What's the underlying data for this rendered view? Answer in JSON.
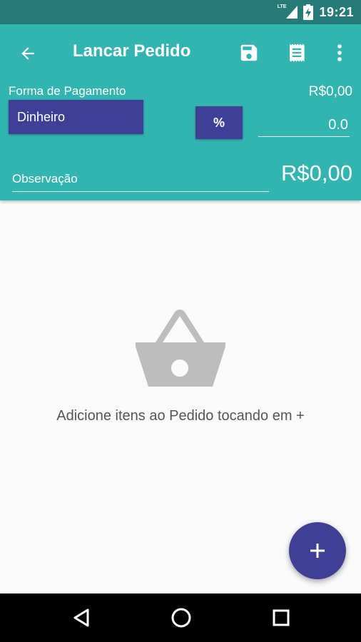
{
  "status_bar": {
    "network_label": "LTE",
    "time": "19:21",
    "icons": [
      "lte-signal-icon",
      "battery-charging-icon"
    ]
  },
  "app_bar": {
    "title": "Lancar Pedido",
    "icons": [
      "back-arrow-icon",
      "save-icon",
      "receipt-icon",
      "more-vert-icon"
    ]
  },
  "payment": {
    "label": "Forma de Pagamento",
    "selected": "Dinheiro",
    "subtotal": "R$0,00",
    "percent_button": "%",
    "discount_value": "0.0"
  },
  "observation": {
    "placeholder": "Observação"
  },
  "total": "R$0,00",
  "empty_state": {
    "icon": "shopping-basket-icon",
    "message": "Adicione itens ao Pedido tocando em +"
  },
  "fab": {
    "icon": "plus-icon"
  },
  "nav_bar": {
    "icons": [
      "nav-back-icon",
      "nav-home-icon",
      "nav-recents-icon"
    ]
  },
  "colors": {
    "status_bar": "#267a78",
    "primary": "#32b5b0",
    "accent": "#3f3f96",
    "background": "#fafafa",
    "empty_icon": "#bdbdbd"
  }
}
